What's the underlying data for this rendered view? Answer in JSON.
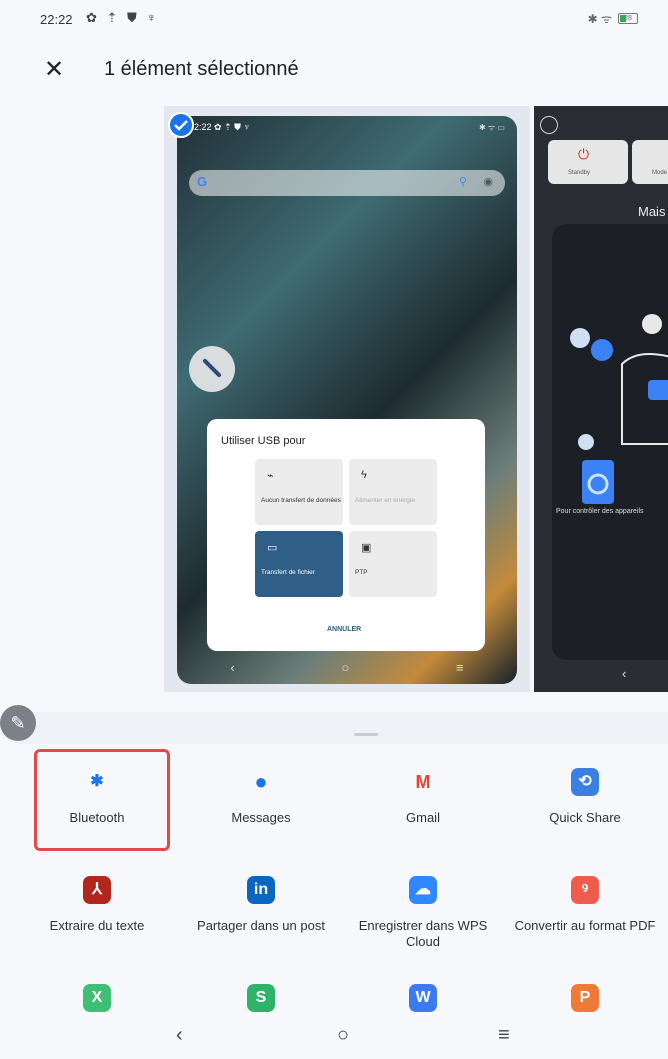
{
  "status": {
    "time": "22:22",
    "left_icons": "✿ ⇡ ⛊ ♆",
    "right_icons": "✱ ᯤ",
    "battery": "28"
  },
  "header": {
    "close": "✕",
    "title": "1 élément sélectionné"
  },
  "preview": {
    "shot1": {
      "status_time": "22:22 ✿ ⇡ ⛊ ♆",
      "status_right": "✱ ᯤ ▭",
      "usb_dialog": {
        "title": "Utiliser USB pour",
        "options": [
          {
            "icon": "⌁",
            "label": "Aucun transfert de données"
          },
          {
            "icon": "ϟ",
            "label": "Alimenter en énergie"
          },
          {
            "icon": "▭",
            "label": "Transfert de fichier"
          },
          {
            "icon": "▣",
            "label": "PTP"
          }
        ],
        "cancel": "ANNULER"
      },
      "nav": [
        "‹",
        "○",
        "≡"
      ]
    },
    "shot2": {
      "tiles": [
        "Standby",
        "Mode"
      ],
      "title_fragment": "Mais",
      "small_text": "Pour contrôler des appareils",
      "back": "‹"
    }
  },
  "apps": [
    {
      "name": "Bluetooth",
      "icon": "✱",
      "color": "#ffffff",
      "fg": "#1a73e8"
    },
    {
      "name": "Messages",
      "icon": "●",
      "color": "#ffffff",
      "fg": "#1a73e8"
    },
    {
      "name": "Gmail",
      "icon": "M",
      "color": "#ffffff",
      "fg": "#ea4335"
    },
    {
      "name": "Quick Share",
      "icon": "⟲",
      "color": "#3b7fe3",
      "fg": "#ffffff"
    },
    {
      "name": "Extraire du texte",
      "icon": "⅄",
      "color": "#b3261e",
      "fg": "#ffffff"
    },
    {
      "name": "Partager dans un post",
      "icon": "in",
      "color": "#0a66c2",
      "fg": "#ffffff"
    },
    {
      "name": "Enregistrer dans WPS Cloud",
      "icon": "☁",
      "color": "#2f88ff",
      "fg": "#ffffff"
    },
    {
      "name": "Convertir au format PDF",
      "icon": "ꝰ",
      "color": "#ef5b4c",
      "fg": "#ffffff"
    },
    {
      "name": "",
      "icon": "X",
      "color": "#3fbf75",
      "fg": "#ffffff"
    },
    {
      "name": "",
      "icon": "S",
      "color": "#2fb36a",
      "fg": "#ffffff"
    },
    {
      "name": "",
      "icon": "W",
      "color": "#3a7cf0",
      "fg": "#ffffff"
    },
    {
      "name": "",
      "icon": "P",
      "color": "#f07a35",
      "fg": "#ffffff"
    }
  ],
  "nav": {
    "back": "‹",
    "home": "○",
    "recents": "≡"
  }
}
